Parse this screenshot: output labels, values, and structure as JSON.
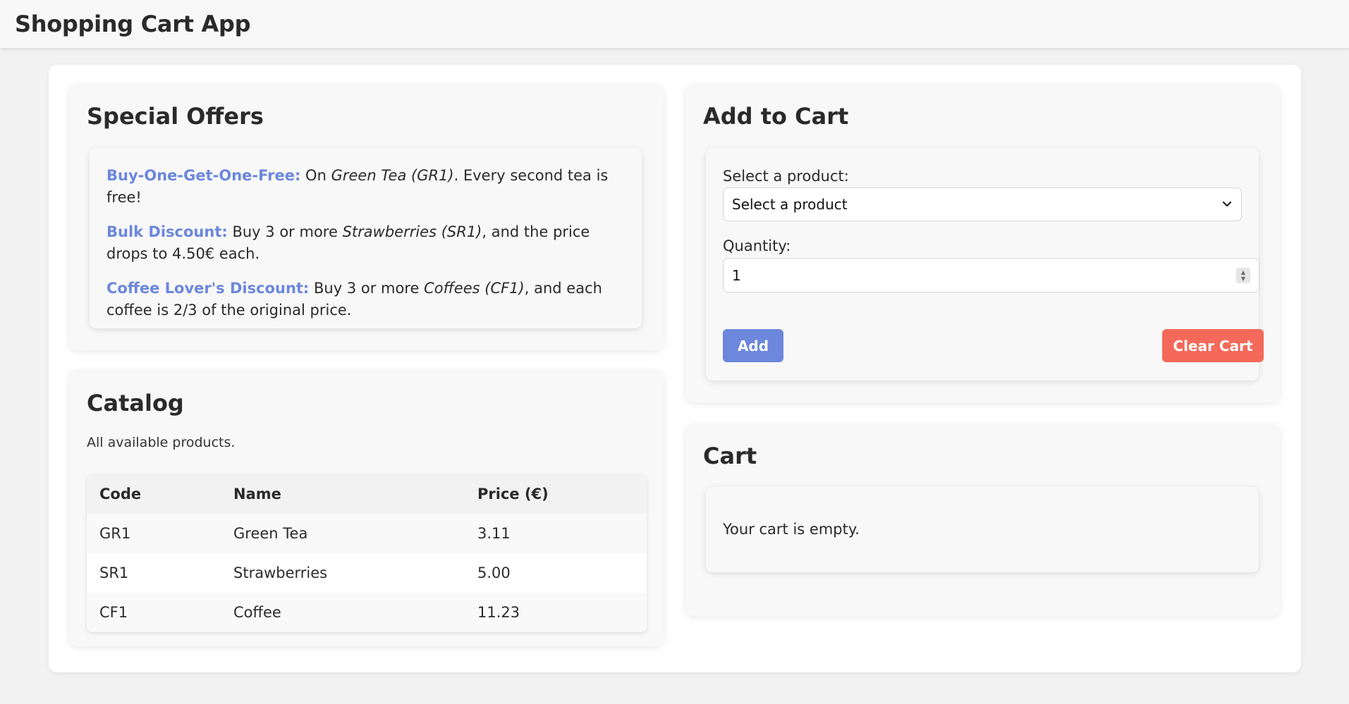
{
  "app": {
    "title": "Shopping Cart App"
  },
  "offers": {
    "heading": "Special Offers",
    "items": [
      {
        "title": "Buy-One-Get-One-Free:",
        "pre": "On",
        "product": "Green Tea (GR1)",
        "post": ". Every second tea is free!"
      },
      {
        "title": "Bulk Discount:",
        "pre": "Buy 3 or more",
        "product": "Strawberries (SR1)",
        "post": ", and the price drops to 4.50€ each."
      },
      {
        "title": "Coffee Lover's Discount:",
        "pre": "Buy 3 or more",
        "product": "Coffees (CF1)",
        "post": ", and each coffee is 2/3 of the original price."
      }
    ]
  },
  "catalog": {
    "heading": "Catalog",
    "description": "All available products.",
    "columns": [
      "Code",
      "Name",
      "Price (€)"
    ],
    "rows": [
      [
        "GR1",
        "Green Tea",
        "3.11"
      ],
      [
        "SR1",
        "Strawberries",
        "5.00"
      ],
      [
        "CF1",
        "Coffee",
        "11.23"
      ]
    ]
  },
  "add_to_cart": {
    "heading": "Add to Cart",
    "product_label": "Select a product:",
    "product_selected": "Select a product",
    "quantity_label": "Quantity:",
    "quantity_value": "1",
    "add_label": "Add",
    "clear_label": "Clear Cart"
  },
  "cart": {
    "heading": "Cart",
    "empty_text": "Your cart is empty."
  },
  "colors": {
    "accent": "#6c87dc",
    "danger": "#f5695a",
    "background": "#f2f2f2"
  }
}
